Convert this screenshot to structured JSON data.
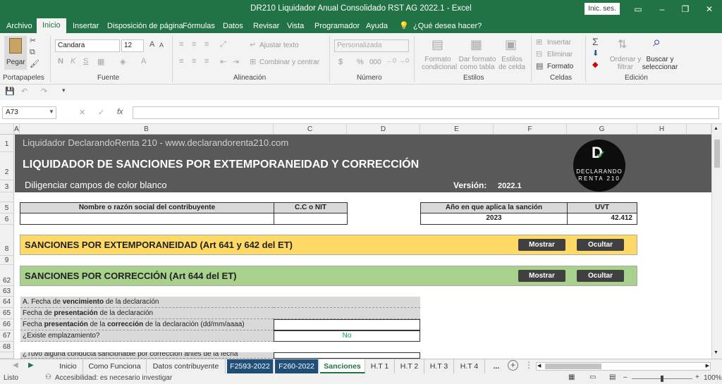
{
  "window": {
    "title": "DR210 Liquidador Anual Consolidado RST AG 2022.1  -  Excel",
    "sign_in": "Inic. ses."
  },
  "tabs": [
    "Archivo",
    "Inicio",
    "Insertar",
    "Disposición de página",
    "Fórmulas",
    "Datos",
    "Revisar",
    "Vista",
    "Programador",
    "Ayuda",
    "¿Qué desea hacer?"
  ],
  "ribbon": {
    "clipboard": {
      "paste": "Pegar",
      "label": "Portapapeles"
    },
    "font": {
      "name": "Candara",
      "size": "12",
      "label": "Fuente",
      "bold": "N",
      "italic": "K",
      "underline": "S"
    },
    "alignment": {
      "wrap": "Ajustar texto",
      "merge": "Combinar y centrar",
      "label": "Alineación"
    },
    "number": {
      "format": "Personalizada",
      "currency": "$",
      "percent": "%",
      "thousands": "000",
      "label": "Número"
    },
    "styles": {
      "conditional": "Formato condicional",
      "as_table": "Dar formato como tabla",
      "cell_styles": "Estilos de celda",
      "label": "Estilos"
    },
    "cells": {
      "insert": "Insertar",
      "delete": "Eliminar",
      "format": "Formato",
      "label": "Celdas"
    },
    "editing": {
      "sort": "Ordenar y filtrar",
      "find": "Buscar y seleccionar",
      "label": "Edición"
    }
  },
  "formula_bar": {
    "name_box": "A73",
    "fx": "fx",
    "value": ""
  },
  "columns": [
    "A",
    "B",
    "C",
    "D",
    "E",
    "F",
    "G",
    "H"
  ],
  "rows": [
    "1",
    "2",
    "3",
    "5",
    "6",
    "8",
    "9",
    "62",
    "63",
    "64",
    "65",
    "66",
    "67",
    "68"
  ],
  "sheet": {
    "banner_subtitle": "Liquidador DeclarandoRenta 210 - www.declarandorenta210.com",
    "banner_title": "LIQUIDADOR DE SANCIONES POR EXTEMPORANEIDAD Y CORRECCIÓN",
    "banner_hint": "Diligenciar campos de color blanco",
    "version_label": "Versión:",
    "version_value": "2022.1",
    "logo_letter": "D",
    "logo_line1": "DECLARANDO",
    "logo_line2": "RENTA 210",
    "name_header": "Nombre o razón social del contribuyente",
    "id_header": "C.C o NIT",
    "year_header": "Año en que aplica la sanción",
    "uvt_header": "UVT",
    "year_value": "2023",
    "uvt_value": "42.412",
    "section_extemp": "SANCIONES POR EXTEMPORANEIDAD (Art 641 y 642 del ET)",
    "section_correction": "SANCIONES POR CORRECCIÓN (Art 644 del ET)",
    "show_btn": "Mostrar",
    "hide_btn": "Ocultar",
    "row64_pre": "A. Fecha de ",
    "row64_bold": "vencimiento",
    "row64_post": " de la declaración",
    "row65_pre": "Fecha de ",
    "row65_bold": "presentación",
    "row65_post": " de la declaración",
    "row66_pre": "Fecha ",
    "row66_bold1": "presentación",
    "row66_mid": " de la ",
    "row66_bold2": "corrección",
    "row66_post": " de la declaración (dd/mm/aaaa)",
    "row67": "¿Existe emplazamiento?",
    "row67_value": "No",
    "row68_partial": "¿Tuvo alguna conducta sancionable por corrección antes de la fecha"
  },
  "sheet_tabs": [
    "Inicio",
    "Como Funciona",
    "Datos contribuyente",
    "F2593-2022",
    "F260-2022",
    "Sanciones",
    "H.T 1",
    "H.T 2",
    "H.T 3",
    "H.T 4",
    "..."
  ],
  "status": {
    "ready": "Listo",
    "accessibility": "Accesibilidad: es necesario investigar",
    "zoom": "100%"
  },
  "colors": {
    "excel_green": "#217346",
    "banner": "#595959",
    "extemp": "#ffd966",
    "correction": "#a9d18e",
    "tab_blue": "#1f4e79"
  }
}
